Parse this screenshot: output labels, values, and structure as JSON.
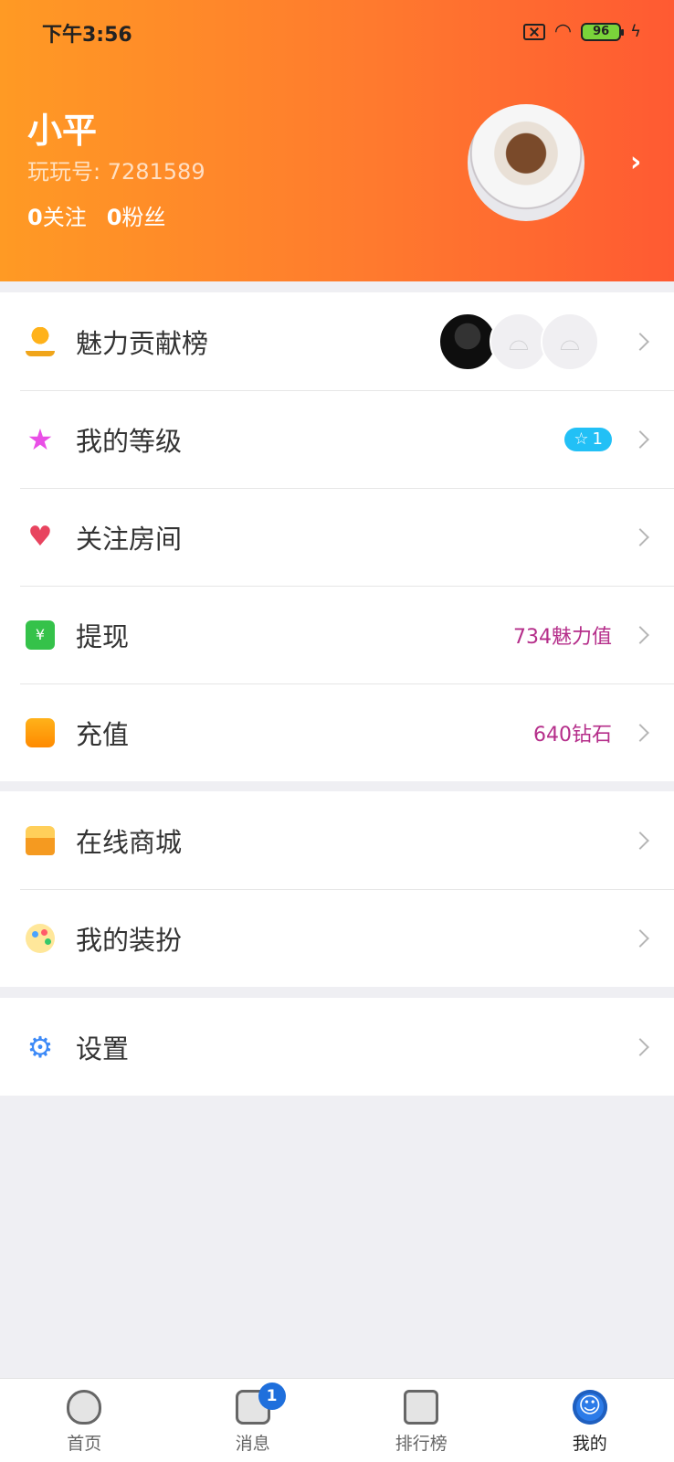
{
  "status_bar": {
    "time": "下午3:56",
    "battery": "96"
  },
  "profile": {
    "name": "小平",
    "uid": "玩玩号: 7281589",
    "follow_count": "0",
    "follow_label": "关注",
    "fans_count": "0",
    "fans_label": "粉丝"
  },
  "menu": {
    "charm": {
      "label": "魅力贡献榜",
      "icon": "trophy-icon"
    },
    "level": {
      "label": "我的等级",
      "badge": "1",
      "icon": "star-icon"
    },
    "rooms": {
      "label": "关注房间",
      "icon": "heart-icon"
    },
    "withdraw": {
      "label": "提现",
      "value": "734魅力值",
      "icon": "cash-icon"
    },
    "recharge": {
      "label": "充值",
      "value": "640钻石",
      "icon": "wallet-icon"
    },
    "shop": {
      "label": "在线商城",
      "icon": "shop-icon"
    },
    "dressup": {
      "label": "我的装扮",
      "icon": "palette-icon"
    },
    "settings": {
      "label": "设置",
      "icon": "gear-icon"
    }
  },
  "tabs": [
    {
      "label": "首页",
      "icon": "home-icon"
    },
    {
      "label": "消息",
      "icon": "message-icon",
      "badge": "1"
    },
    {
      "label": "排行榜",
      "icon": "ranking-icon"
    },
    {
      "label": "我的",
      "icon": "me-icon",
      "active": true
    }
  ],
  "colors": {
    "header_start": "#ff9a24",
    "header_end": "#ff5a32",
    "value_text": "#b52e8a",
    "level_badge": "#22c0f6",
    "active_tab": "#2c7be8"
  }
}
